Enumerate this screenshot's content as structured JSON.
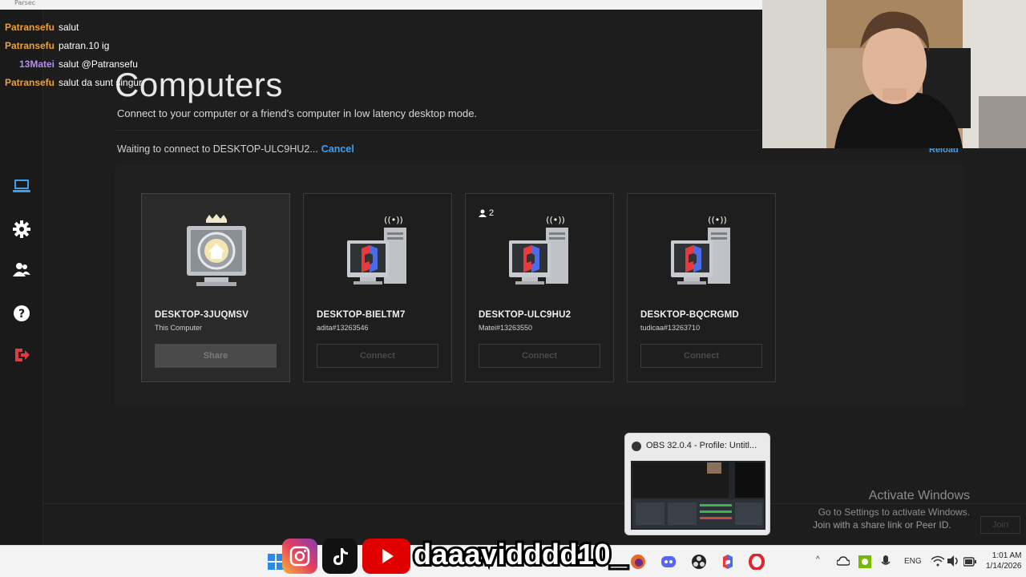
{
  "app": {
    "title": "Computers",
    "subtitle": "Connect to your computer or a friend's computer in low latency desktop mode.",
    "waiting_text": "Waiting to connect to DESKTOP-ULC9HU2...",
    "cancel_label": "Cancel",
    "reload_label": "Reload",
    "topbar_tiny": "Parsec"
  },
  "chat": [
    {
      "user": "Patransefu",
      "message": "salut",
      "color": "#f0a030"
    },
    {
      "user": "Patransefu",
      "message": "patran.10 ig",
      "color": "#f0a030"
    },
    {
      "user": "13Matei",
      "message": "salut @Patransefu",
      "color": "#b58cf0"
    },
    {
      "user": "Patransefu",
      "message": "salut da sunt singur",
      "color": "#f0a030"
    }
  ],
  "sidebar": {
    "items": [
      {
        "name": "computers",
        "icon": "computer-icon"
      },
      {
        "name": "settings",
        "icon": "gear-icon"
      },
      {
        "name": "friends",
        "icon": "people-icon"
      },
      {
        "name": "help",
        "icon": "question-icon"
      },
      {
        "name": "logout",
        "icon": "logout-icon"
      }
    ]
  },
  "computers": [
    {
      "name": "DESKTOP-3JUQMSV",
      "sub": "This Computer",
      "button": "Share",
      "active": true
    },
    {
      "name": "DESKTOP-BIELTM7",
      "sub": "adita#13263546",
      "button": "Connect"
    },
    {
      "name": "DESKTOP-ULC9HU2",
      "sub": "Matei#13263550",
      "button": "Connect",
      "badge": "2"
    },
    {
      "name": "DESKTOP-BQCRGMD",
      "sub": "tudicaa#13263710",
      "button": "Connect"
    }
  ],
  "activate": {
    "line1": "Activate Windows",
    "line2": "Go to Settings to activate Windows."
  },
  "join": {
    "text": "Join with a share link or Peer ID.",
    "button": "Join"
  },
  "obs_popup": {
    "title": "OBS 32.0.4 - Profile: Untitl..."
  },
  "overlay": {
    "handle": "daaavidddd10_"
  },
  "taskbar": {
    "lang": "ENG",
    "time": "1:01 AM",
    "date": "1/14/2026"
  },
  "colors": {
    "accent": "#3d9ff0",
    "parsec_red": "#e8393f",
    "parsec_blue": "#4b6be8"
  }
}
